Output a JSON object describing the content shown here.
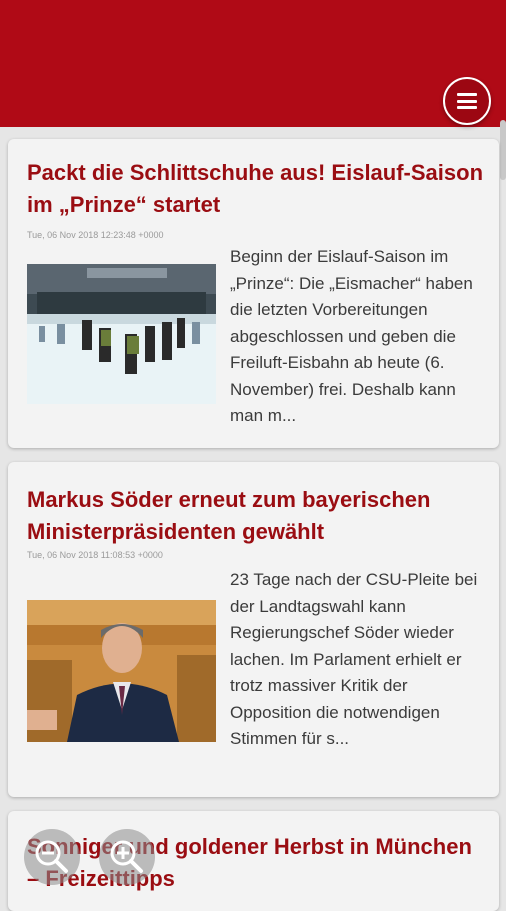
{
  "header": {
    "menu_icon": "hamburger-menu-icon",
    "color": "#b00a16"
  },
  "articles": [
    {
      "title": "Packt die Schlittschuhe aus! Eislauf-Saison im „Prinze“ startet",
      "date": "Tue, 06 Nov 2018 12:23:48 +0000",
      "excerpt": "Beginn der Eislauf-Saison im „Prinze“: Die „Eismacher“ haben die letzten Vorbere­itungen abgeschlossen und geben die Freiluft-Eisbahn ab heute (6. November) frei. Deshalb kann man m..."
    },
    {
      "title": "Markus Söder erneut zum bayerischen Ministerpräsidenten gewählt",
      "date": "Tue, 06 Nov 2018 11:08:53 +0000",
      "excerpt": "23 Tage nach der CSU-Pleite bei der Landtagswahl kann Regierungschef Söder wieder lachen. Im Parlament erhielt er trotz massiver Kritik der Opposition die notwendigen Stimmen für s..."
    },
    {
      "title": "Sonniger und goldener Herbst in München – Freizeittipps"
    }
  ],
  "floating_buttons": [
    {
      "icon": "zoom-out-icon"
    },
    {
      "icon": "zoom-in-icon"
    }
  ]
}
